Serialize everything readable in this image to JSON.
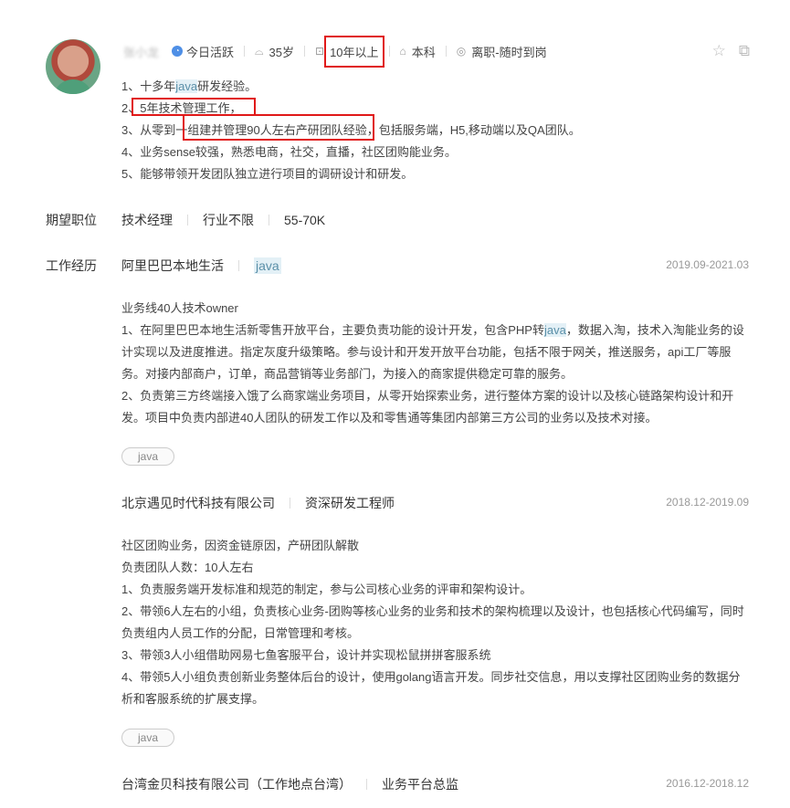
{
  "profile": {
    "name": "张小龙",
    "active": "今日活跃",
    "age": "35岁",
    "experience": "10年以上",
    "education": "本科",
    "status": "离职-随时到岗"
  },
  "summary": [
    {
      "pre": "1、十多年",
      "hl": "java",
      "post": "研发经验。"
    },
    {
      "text": "2、5年技术管理工作，"
    },
    {
      "text": "3、从零到一组建并管理90人左右产研团队经验，包括服务端，H5,移动端以及QA团队。"
    },
    {
      "text": "4、业务sense较强，熟悉电商，社交，直播，社区团购能业务。"
    },
    {
      "text": "5、能够带领开发团队独立进行项目的调研设计和研发。"
    }
  ],
  "expect": {
    "label": "期望职位",
    "position": "技术经理",
    "industry": "行业不限",
    "salary": "55-70K"
  },
  "work": {
    "label": "工作经历",
    "jobs": [
      {
        "company": "阿里巴巴本地生活",
        "title": "java",
        "period": "2019.09-2021.03",
        "lines": [
          "业务线40人技术owner",
          "1、在阿里巴巴本地生活新零售开放平台，主要负责功能的设计开发，包含PHP转java，数据入淘，技术入淘能业务的设",
          "计实现以及进度推进。指定灰度升级策略。参与设计和开发开放平台功能，包括不限于网关，推送服务，api工厂等服",
          "务。对接内部商户，订单，商品营销等业务部门，为接入的商家提供稳定可靠的服务。",
          "2、负责第三方终端接入饿了么商家端业务项目，从零开始探索业务，进行整体方案的设计以及核心链路架构设计和开",
          "发。项目中负责内部进40人团队的研发工作以及和零售通等集团内部第三方公司的业务以及技术对接。"
        ],
        "tag": "java"
      },
      {
        "company": "北京遇见时代科技有限公司",
        "title": "资深研发工程师",
        "period": "2018.12-2019.09",
        "lines": [
          "社区团购业务，因资金链原因，产研团队解散",
          "负责团队人数：10人左右",
          "1、负责服务端开发标准和规范的制定，参与公司核心业务的评审和架构设计。",
          "2、带领6人左右的小组，负责核心业务-团购等核心业务的业务和技术的架构梳理以及设计，也包括核心代码编写，同时",
          "负责组内人员工作的分配，日常管理和考核。",
          "3、带领3人小组借助网易七鱼客服平台，设计并实现松鼠拼拼客服系统",
          "4、带领5人小组负责创新业务整体后台的设计，使用golang语言开发。同步社交信息，用以支撑社区团购业务的数据分",
          "析和客服系统的扩展支撑。"
        ],
        "tag": "java"
      },
      {
        "company": "台湾金贝科技有限公司（工作地点台湾）",
        "title": "业务平台总监",
        "period": "2016.12-2018.12"
      }
    ]
  }
}
